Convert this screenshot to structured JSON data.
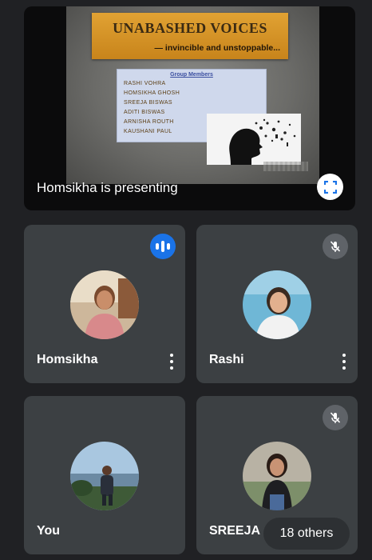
{
  "presentation": {
    "slide": {
      "title": "UNABASHED VOICES",
      "subtitle": "— invincible and unstoppable...",
      "members_heading": "Group Members",
      "members": [
        "RASHI VOHRA",
        "HOMSIKHA GHOSH",
        "SREEJA BISWAS",
        "ADITI BISWAS",
        "ARNISHA ROUTH",
        "KAUSHANI PAUL"
      ]
    },
    "presenting_label": "Homsikha is presenting",
    "fullscreen_icon": "fullscreen-icon"
  },
  "participants": [
    {
      "name": "Homsikha",
      "status": "speaking",
      "status_icon": "audio-level-icon"
    },
    {
      "name": "Rashi",
      "status": "muted",
      "status_icon": "mic-off-icon"
    },
    {
      "name": "You",
      "status": "none"
    },
    {
      "name": "SREEJA",
      "status": "muted",
      "status_icon": "mic-off-icon"
    }
  ],
  "others_chip": "18 others",
  "colors": {
    "background": "#202124",
    "tile": "#3c4043",
    "speaking_accent": "#1a73e8",
    "muted_badge": "#5f6368",
    "slide_title_box": "#d79528"
  }
}
